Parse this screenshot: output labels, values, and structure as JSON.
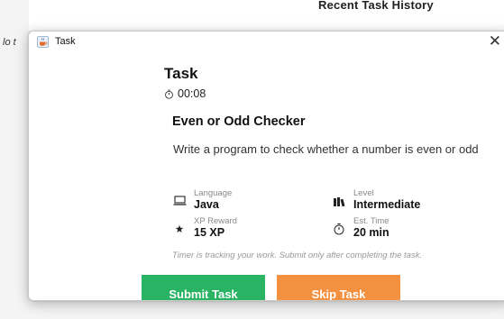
{
  "background": {
    "heading": "Recent Task History",
    "left_text": "lo t"
  },
  "window": {
    "title": "Task",
    "icon": "java-cup-icon",
    "close_icon": "close-icon",
    "close_label": "✕"
  },
  "task": {
    "heading": "Task",
    "timer_icon": "stopwatch-icon",
    "timer": "00:08",
    "name": "Even or Odd Checker",
    "description": "Write a program to check whether a number is even or odd",
    "meta": {
      "language_label": "Language",
      "language_value": "Java",
      "language_icon": "laptop-icon",
      "level_label": "Level",
      "level_value": "Intermediate",
      "level_icon": "books-icon",
      "xp_label": "XP Reward",
      "xp_value": "15 XP",
      "xp_icon": "star-icon",
      "time_label": "Est. Time",
      "time_value": "20 min",
      "time_icon": "stopwatch-icon"
    },
    "note": "Timer is tracking your work. Submit only after completing the task."
  },
  "buttons": {
    "submit_label": "Submit Task",
    "submit_color": "#28b463",
    "skip_label": "Skip Task",
    "skip_color": "#f39140"
  }
}
